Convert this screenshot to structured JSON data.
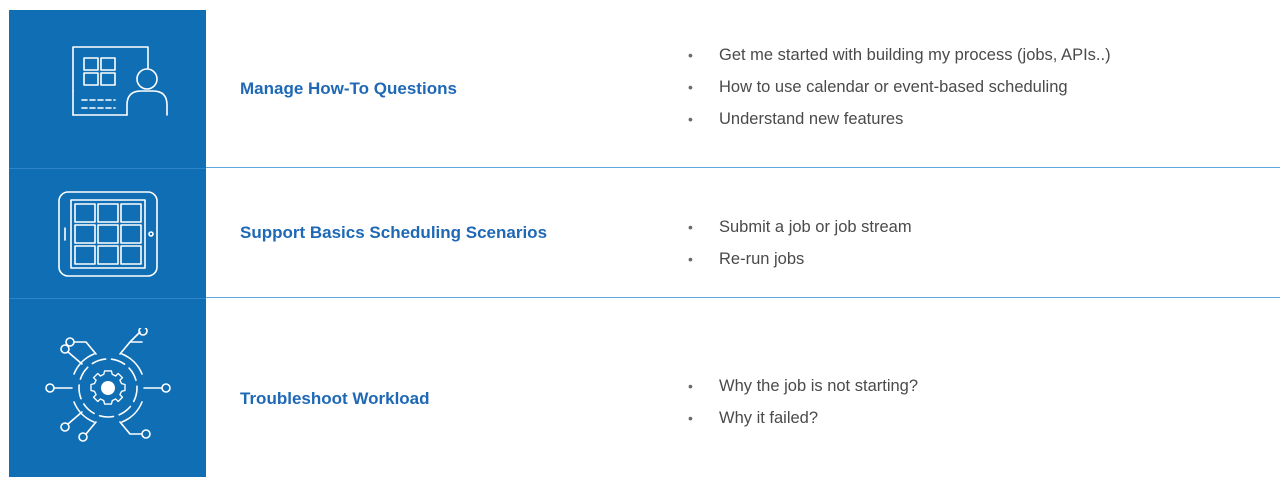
{
  "colors": {
    "accent_blue": "#106eb5",
    "title_blue": "#1e68b5",
    "body_text": "#4a4a4a",
    "divider": "#5da8de"
  },
  "rows": [
    {
      "icon": "presentation-board-person-icon",
      "title": "Manage How-To Questions",
      "bullets": [
        "Get me started with building my process (jobs, APIs..)",
        "How to use calendar or event-based scheduling",
        "Understand new features"
      ]
    },
    {
      "icon": "tablet-grid-calendar-icon",
      "title": "Support Basics Scheduling Scenarios",
      "bullets": [
        "Submit a job or job stream",
        "Re-run jobs"
      ]
    },
    {
      "icon": "gear-network-icon",
      "title": "Troubleshoot Workload",
      "bullets": [
        "Why the job is not starting?",
        "Why it failed?"
      ]
    }
  ],
  "bullet_symbol": "•"
}
